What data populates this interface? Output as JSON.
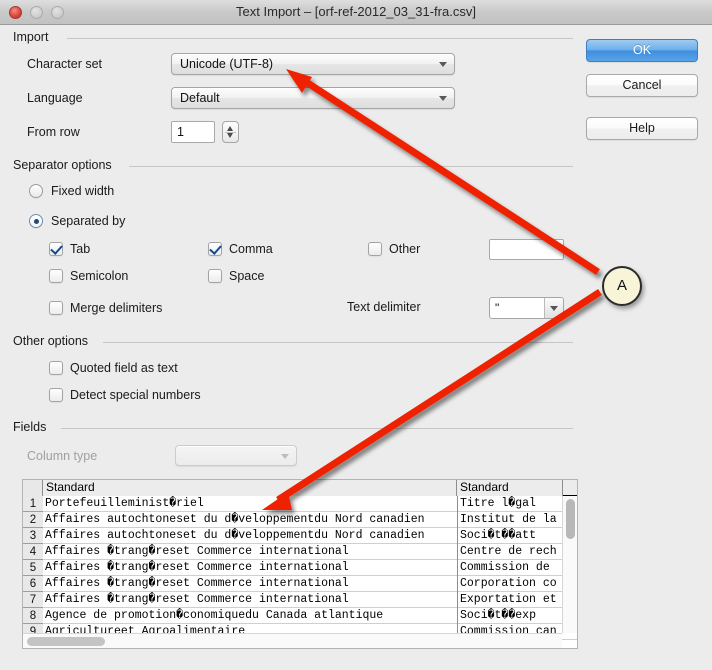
{
  "window": {
    "title": "Text Import – [orf-ref-2012_03_31-fra.csv]",
    "close_label": "",
    "minimize_label": "",
    "zoom_label": ""
  },
  "buttons": {
    "ok": "OK",
    "cancel": "Cancel",
    "help": "Help"
  },
  "import": {
    "legend": "Import",
    "character_set_label": "Character set",
    "character_set_value": "Unicode (UTF-8)",
    "language_label": "Language",
    "language_value": "Default",
    "from_row_label": "From row",
    "from_row_value": "1"
  },
  "separator": {
    "legend": "Separator options",
    "fixed_width_label": "Fixed width",
    "fixed_width_checked": false,
    "separated_by_label": "Separated by",
    "separated_by_checked": true,
    "tab_label": "Tab",
    "tab_checked": true,
    "comma_label": "Comma",
    "comma_checked": true,
    "other_label": "Other",
    "other_checked": false,
    "other_value": "",
    "semicolon_label": "Semicolon",
    "semicolon_checked": false,
    "space_label": "Space",
    "space_checked": false,
    "merge_delimiters_label": "Merge delimiters",
    "merge_delimiters_checked": false,
    "text_delimiter_label": "Text delimiter",
    "text_delimiter_value": "\""
  },
  "other_options": {
    "legend": "Other options",
    "quoted_field_label": "Quoted field as text",
    "quoted_field_checked": false,
    "detect_special_numbers_label": "Detect special numbers",
    "detect_special_numbers_checked": false
  },
  "fields": {
    "legend": "Fields",
    "column_type_label": "Column type",
    "column_type_value": "",
    "column_type_disabled": true,
    "columns": [
      "Standard",
      "Standard"
    ],
    "rows": [
      {
        "n": "1",
        "c1": "Portefeuille",
        "c1b": "ministu000briel",
        "c2": "Titre lu000bgal"
      },
      {
        "n": "2",
        "c1": "Affaires autochtones",
        "c1b": "et du du000bveloppement",
        "c1c": "du Nord canadien",
        "c2": "Institut de la"
      },
      {
        "n": "3",
        "c1": "Affaires autochtones",
        "c1b": "et du du000bveloppement",
        "c1c": "du Nord canadien",
        "c2": "Sociu000btu000bu000batt"
      },
      {
        "n": "4",
        "c1": "Affaires u000btrangu000bres",
        "c1b": "et Commerce international",
        "c2": "Centre de rech"
      },
      {
        "n": "5",
        "c1": "Affaires u000btrangu000bres",
        "c1b": "et Commerce international",
        "c2": "Commission de"
      },
      {
        "n": "6",
        "c1": "Affaires u000btrangu000bres",
        "c1b": "et Commerce international",
        "c2": "Corporation co"
      },
      {
        "n": "7",
        "c1": "Affaires u000btrangu000bres",
        "c1b": "et Commerce international",
        "c2": "Exportation et"
      },
      {
        "n": "8",
        "c1": "Agence de promotion",
        "c1b": "u000bconomique",
        "c1c": "du Canada atlantique",
        "c2": "Sociu000btu000bu000bexp"
      },
      {
        "n": "9",
        "c1": "Agriculture",
        "c1b": "et Agroalimentaire",
        "c2": "Commission can"
      }
    ]
  },
  "annotation": {
    "callout_label": "A",
    "arrow_color": "#ee2200"
  }
}
